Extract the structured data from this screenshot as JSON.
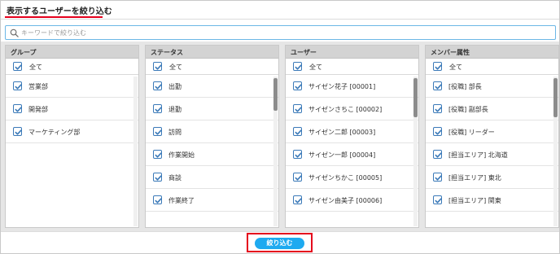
{
  "dialog": {
    "title": "表示するユーザーを絞り込む"
  },
  "search": {
    "placeholder": "キーワードで絞り込む",
    "value": ""
  },
  "columns": [
    {
      "header": "グループ",
      "all_label": "全て",
      "all_checked": true,
      "items": [
        {
          "label": "営業部",
          "checked": true
        },
        {
          "label": "開発部",
          "checked": true
        },
        {
          "label": "マーケティング部",
          "checked": true
        }
      ]
    },
    {
      "header": "ステータス",
      "all_label": "全て",
      "all_checked": true,
      "items": [
        {
          "label": "出勤",
          "checked": true
        },
        {
          "label": "退勤",
          "checked": true
        },
        {
          "label": "訪問",
          "checked": true
        },
        {
          "label": "作業開始",
          "checked": true
        },
        {
          "label": "商談",
          "checked": true
        },
        {
          "label": "作業終了",
          "checked": true
        }
      ]
    },
    {
      "header": "ユーザー",
      "all_label": "全て",
      "all_checked": true,
      "items": [
        {
          "label": "サイゼン花子 [00001]",
          "checked": true
        },
        {
          "label": "サイゼンさちこ [00002]",
          "checked": true
        },
        {
          "label": "サイゼン二郎 [00003]",
          "checked": true
        },
        {
          "label": "サイゼン一郎 [00004]",
          "checked": true
        },
        {
          "label": "サイゼンちかこ [00005]",
          "checked": true
        },
        {
          "label": "サイゼン由美子 [00006]",
          "checked": true
        }
      ]
    },
    {
      "header": "メンバー属性",
      "all_label": "全て",
      "all_checked": true,
      "items": [
        {
          "label": "[役職] 部長",
          "checked": true
        },
        {
          "label": "[役職] 副部長",
          "checked": true
        },
        {
          "label": "[役職] リーダー",
          "checked": true
        },
        {
          "label": "[担当エリア] 北海道",
          "checked": true
        },
        {
          "label": "[担当エリア] 東北",
          "checked": true
        },
        {
          "label": "[担当エリア] 関東",
          "checked": true
        }
      ]
    }
  ],
  "footer": {
    "submit_label": "絞り込む"
  },
  "colors": {
    "accent_blue": "#1eaaf0",
    "checkbox_blue": "#3a79b8",
    "highlight_red": "#e5001c"
  }
}
